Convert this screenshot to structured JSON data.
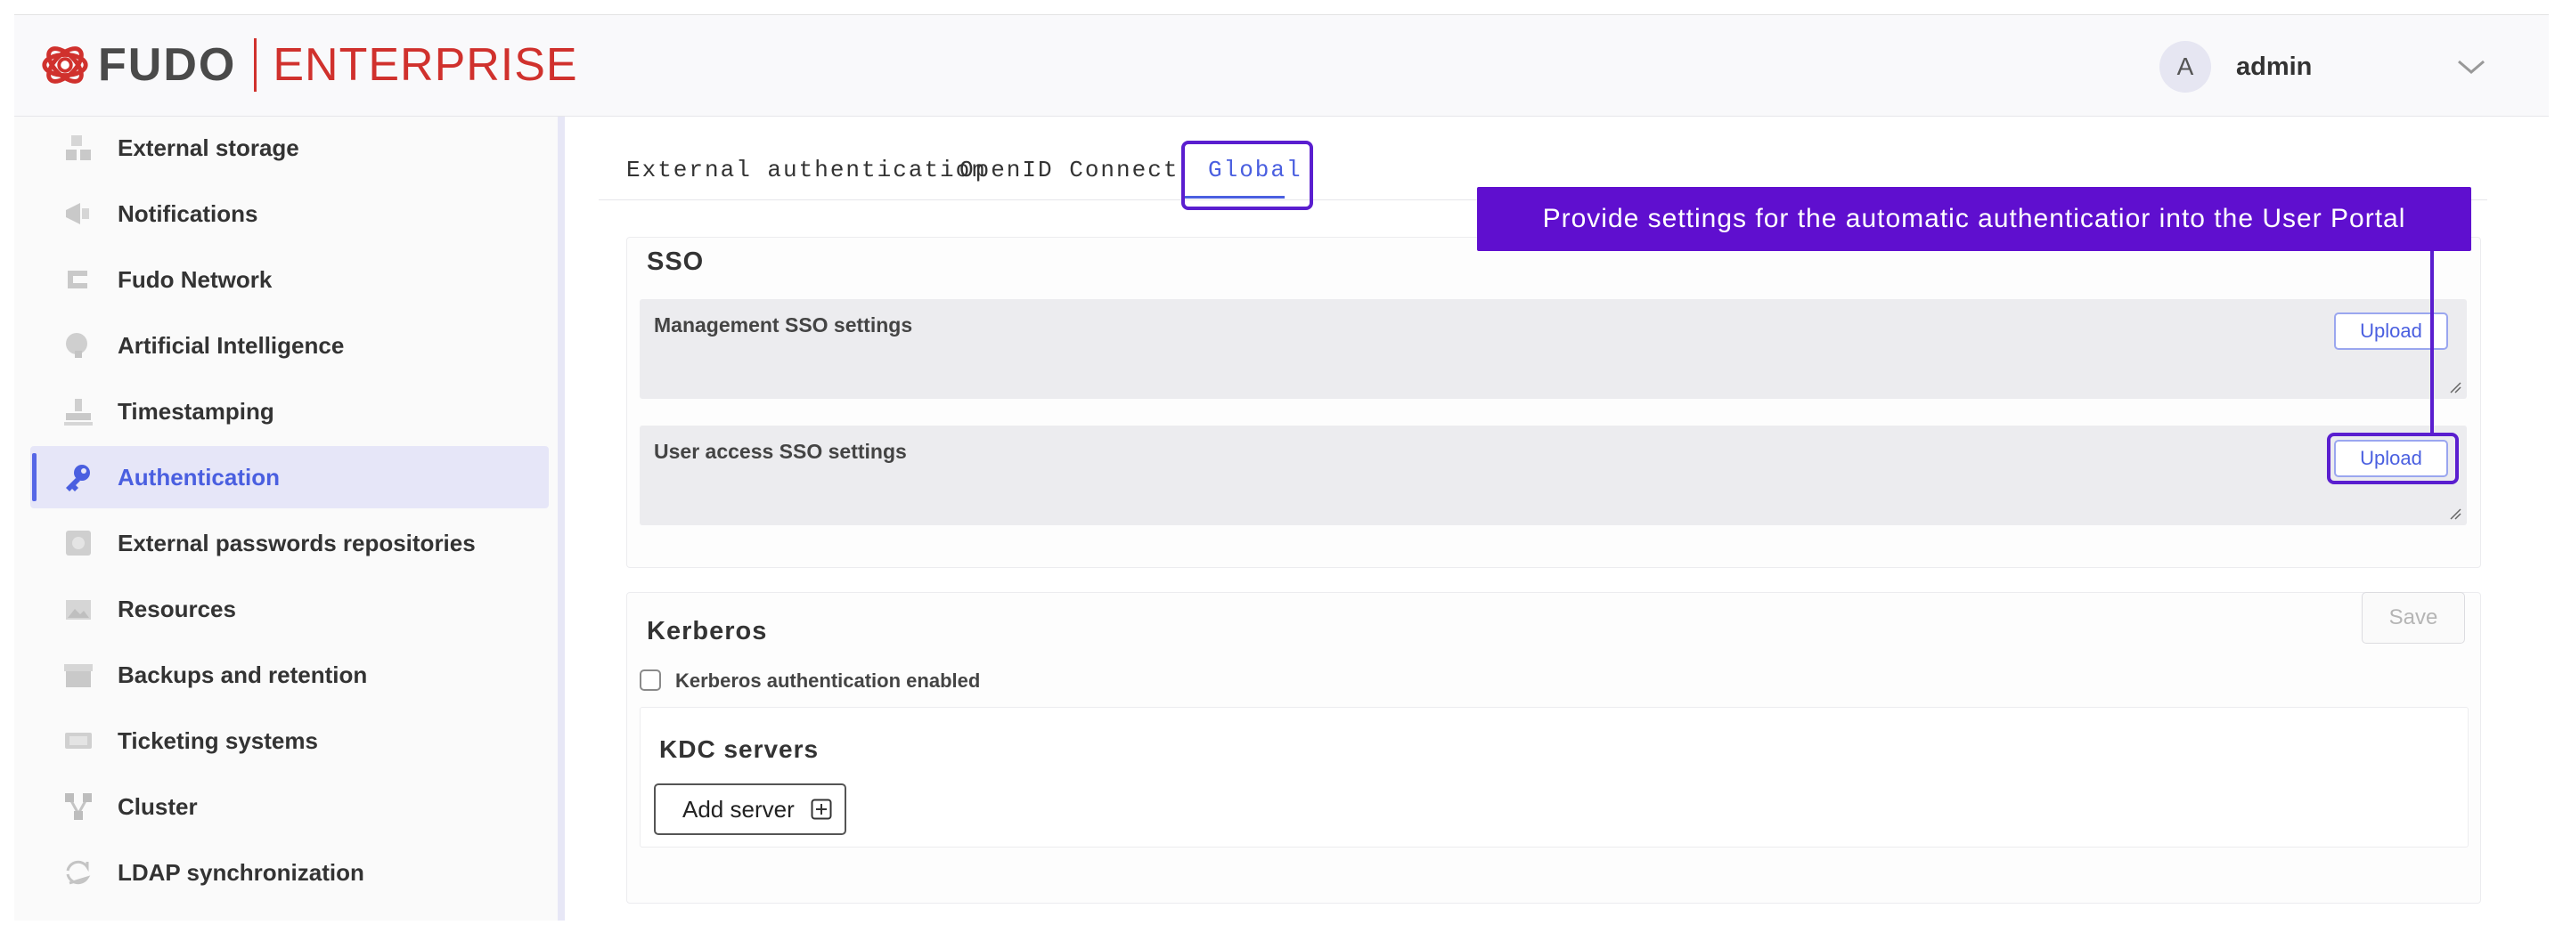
{
  "brand": {
    "name": "FUDO",
    "edition": "ENTERPRISE",
    "accent": "#d0312d"
  },
  "user": {
    "initial": "A",
    "name": "admin"
  },
  "sidebar": {
    "items": [
      {
        "label": "External storage",
        "icon": "external-storage-icon",
        "active": false
      },
      {
        "label": "Notifications",
        "icon": "megaphone-icon",
        "active": false
      },
      {
        "label": "Fudo Network",
        "icon": "network-icon",
        "active": false
      },
      {
        "label": "Artificial Intelligence",
        "icon": "brain-icon",
        "active": false
      },
      {
        "label": "Timestamping",
        "icon": "stamp-icon",
        "active": false
      },
      {
        "label": "Authentication",
        "icon": "key-icon",
        "active": true
      },
      {
        "label": "External passwords repositories",
        "icon": "safe-icon",
        "active": false
      },
      {
        "label": "Resources",
        "icon": "image-icon",
        "active": false
      },
      {
        "label": "Backups and retention",
        "icon": "archive-icon",
        "active": false
      },
      {
        "label": "Ticketing systems",
        "icon": "ticket-icon",
        "active": false
      },
      {
        "label": "Cluster",
        "icon": "cluster-icon",
        "active": false
      },
      {
        "label": "LDAP synchronization",
        "icon": "sync-icon",
        "active": false
      }
    ]
  },
  "tabs": [
    {
      "label": "External authentication",
      "active": false
    },
    {
      "label": "OpenID Connect",
      "active": false
    },
    {
      "label": "Global",
      "active": true
    }
  ],
  "sso": {
    "title": "SSO",
    "management": {
      "label": "Management SSO settings",
      "button": "Upload"
    },
    "user_access": {
      "label": "User access SSO settings",
      "button": "Upload"
    }
  },
  "kerberos": {
    "title": "Kerberos",
    "save": "Save",
    "checkbox_label": "Kerberos authentication enabled",
    "checked": false,
    "kdc": {
      "title": "KDC servers",
      "add_button": "Add server"
    }
  },
  "callout": {
    "text": "Provide settings for the automatic authenticatior into the User Portal",
    "color": "#5f0fcf"
  },
  "colors": {
    "accent": "#4a5fe0",
    "highlight": "#5a1ecf"
  }
}
